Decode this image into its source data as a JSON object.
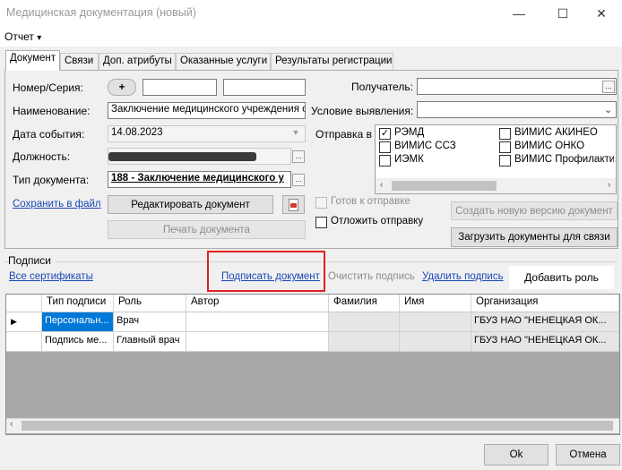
{
  "window": {
    "title": "Медицинская документация (новый)",
    "minimize_glyph": "—",
    "maximize_glyph": "☐",
    "close_glyph": "✕"
  },
  "menu": {
    "report": "Отчет",
    "arrow": "▾"
  },
  "tabs": [
    {
      "label": "Документ"
    },
    {
      "label": "Связи"
    },
    {
      "label": "Доп. атрибуты"
    },
    {
      "label": "Оказанные услуги"
    },
    {
      "label": "Результаты регистрации"
    }
  ],
  "form": {
    "number_label": "Номер/Серия:",
    "number_plus": "+",
    "name_label": "Наименование:",
    "name_value": "Заключение медицинского учреждения о н",
    "event_date_label": "Дата события:",
    "event_date_value": "14.08.2023",
    "position_label": "Должность:",
    "doc_type_label": "Тип документа:",
    "doc_type_value": "188 - Заключение медицинского у",
    "save_to_file": "Сохранить в файл",
    "edit_document": "Редактировать документ",
    "print_document": "Печать документа",
    "recipient_label": "Получатель:",
    "detection_label": "Условие выявления:",
    "send_to_label": "Отправка в",
    "send_targets": [
      {
        "label": "РЭМД",
        "checked": true
      },
      {
        "label": "ВИМИС АКИНЕО",
        "checked": false
      },
      {
        "label": "ВИМИС ССЗ",
        "checked": false
      },
      {
        "label": "ВИМИС ОНКО",
        "checked": false
      },
      {
        "label": "ИЭМК",
        "checked": false
      },
      {
        "label": "ВИМИС Профилактика",
        "checked": false
      }
    ],
    "ready_to_send": "Готов к отправке",
    "postpone_send": "Отложить отправку",
    "create_new_version": "Создать новую версию документ",
    "load_docs_for_link": "Загрузить документы для связи",
    "dots": "..."
  },
  "signatures": {
    "group_label": "Подписи",
    "all_certificates": "Все сертификаты",
    "sign_document": "Подписать документ",
    "clear_signature": "Очистить подпись",
    "delete_signature": "Удалить подпись",
    "add_role": "Добавить роль",
    "columns": [
      "Тип подписи",
      "Роль",
      "Автор",
      "Фамилия",
      "Имя",
      "Организация"
    ],
    "rows": [
      {
        "type": "Персональн...",
        "role": "Врач",
        "author": "",
        "surname": "",
        "name": "",
        "org": "ГБУЗ НАО \"НЕНЕЦКАЯ ОК..."
      },
      {
        "type": "Подпись ме...",
        "role": "Главный врач",
        "author": "",
        "surname": "",
        "name": "",
        "org": "ГБУЗ НАО \"НЕНЕЦКАЯ ОК..."
      }
    ],
    "current_row_marker": "▶"
  },
  "footer": {
    "ok": "Ok",
    "cancel": "Отмена"
  },
  "colors": {
    "highlight_box": "#e02020",
    "selected_cell": "#0078d7",
    "link": "#1a47b8"
  }
}
